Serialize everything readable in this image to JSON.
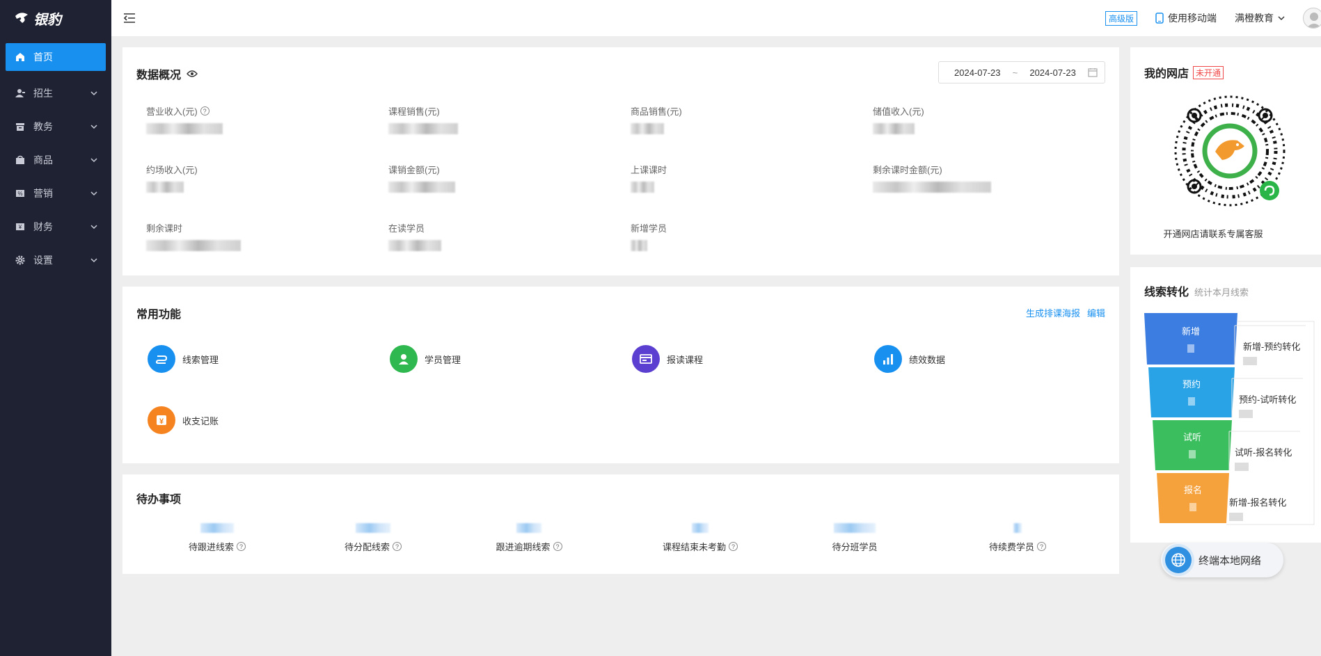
{
  "app": {
    "logo_text": "银豹"
  },
  "sidebar": {
    "items": [
      {
        "label": "首页",
        "icon": "home-icon",
        "active": true
      },
      {
        "label": "招生",
        "icon": "users-icon"
      },
      {
        "label": "教务",
        "icon": "archive-icon"
      },
      {
        "label": "商品",
        "icon": "bag-icon"
      },
      {
        "label": "营销",
        "icon": "ticket-icon"
      },
      {
        "label": "财务",
        "icon": "finance-icon"
      },
      {
        "label": "设置",
        "icon": "gear-icon"
      }
    ]
  },
  "header": {
    "edition_badge": "高级版",
    "mobile_label": "使用移动端",
    "org_name": "满橙教育"
  },
  "overview": {
    "title": "数据概况",
    "date_start": "2024-07-23",
    "date_sep": "~",
    "date_end": "2024-07-23",
    "stats": [
      {
        "label": "营业收入(元)"
      },
      {
        "label": "课程销售(元)"
      },
      {
        "label": "商品销售(元)"
      },
      {
        "label": "储值收入(元)"
      },
      {
        "label": "约场收入(元)"
      },
      {
        "label": "课销金额(元)"
      },
      {
        "label": "上课课时"
      },
      {
        "label": "剩余课时金额(元)"
      },
      {
        "label": "剩余课时"
      },
      {
        "label": "在读学员"
      },
      {
        "label": "新增学员"
      }
    ]
  },
  "common": {
    "title": "常用功能",
    "link_poster": "生成排课海报",
    "link_edit": "编辑",
    "functions": [
      {
        "label": "线索管理",
        "icon": "lead-icon",
        "color": "#1890f0"
      },
      {
        "label": "学员管理",
        "icon": "student-icon",
        "color": "#2fb84f"
      },
      {
        "label": "报读课程",
        "icon": "enroll-icon",
        "color": "#5b3fd0"
      },
      {
        "label": "绩效数据",
        "icon": "bar-chart-icon",
        "color": "#1890f0"
      },
      {
        "label": "收支记账",
        "icon": "yen-icon",
        "color": "#f5831f"
      }
    ]
  },
  "todo": {
    "title": "待办事项",
    "items": [
      {
        "label": "待跟进线索"
      },
      {
        "label": "待分配线索"
      },
      {
        "label": "跟进逾期线索"
      },
      {
        "label": "课程结束未考勤"
      },
      {
        "label": "待分班学员"
      },
      {
        "label": "待续费学员"
      }
    ]
  },
  "shop": {
    "title": "我的网店",
    "status": "未开通",
    "note": "开通网店请联系专属客服"
  },
  "funnel": {
    "title": "线索转化",
    "subtitle": "统计本月线索",
    "stages": [
      {
        "label": "新增",
        "color": "#3b7de0"
      },
      {
        "label": "预约",
        "color": "#2aa3e6"
      },
      {
        "label": "试听",
        "color": "#3bbf5e"
      },
      {
        "label": "报名",
        "color": "#f6a23c"
      }
    ],
    "conversions": [
      {
        "label": "新增-预约转化"
      },
      {
        "label": "预约-试听转化"
      },
      {
        "label": "试听-报名转化"
      },
      {
        "label": "新增-报名转化"
      }
    ]
  },
  "network": {
    "label": "终端本地网络"
  }
}
